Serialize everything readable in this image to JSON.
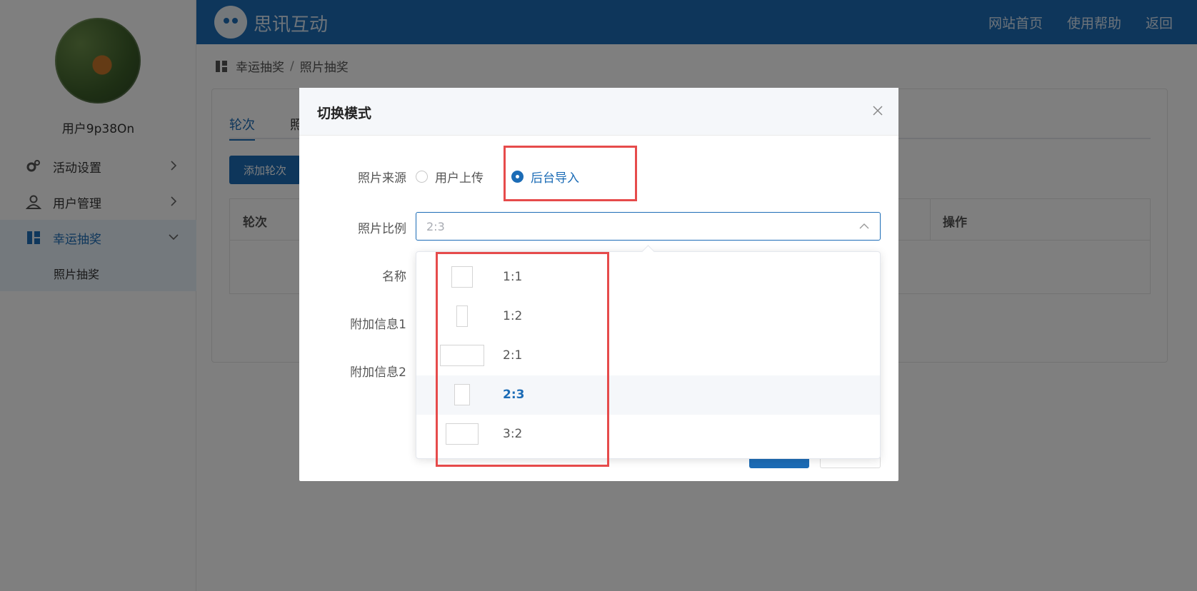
{
  "sidebar": {
    "username": "用户9p38On",
    "items": [
      {
        "label": "活动设置",
        "icon": "gear-icon"
      },
      {
        "label": "用户管理",
        "icon": "user-icon"
      },
      {
        "label": "幸运抽奖",
        "icon": "lottery-icon"
      }
    ],
    "sub_item": "照片抽奖"
  },
  "header": {
    "brand": "思讯互动",
    "nav": [
      "网站首页",
      "使用帮助",
      "返回"
    ]
  },
  "breadcrumb": [
    "幸运抽奖",
    "照片抽奖"
  ],
  "main": {
    "tabs": [
      "轮次",
      "照"
    ],
    "add_button": "添加轮次",
    "table_headers": [
      "轮次",
      "操作"
    ]
  },
  "dialog": {
    "title": "切换模式",
    "labels": {
      "source": "照片来源",
      "ratio": "照片比例",
      "name": "名称",
      "extra1": "附加信息1",
      "extra2": "附加信息2"
    },
    "source_options": [
      {
        "label": "用户上传",
        "checked": false
      },
      {
        "label": "后台导入",
        "checked": true
      }
    ],
    "ratio_value": "2:3",
    "ratio_options": [
      "1:1",
      "1:2",
      "2:1",
      "2:3",
      "3:2"
    ],
    "ratio_selected": "2:3"
  },
  "colors": {
    "primary": "#1c6cb6",
    "highlight": "#e64b4b"
  }
}
